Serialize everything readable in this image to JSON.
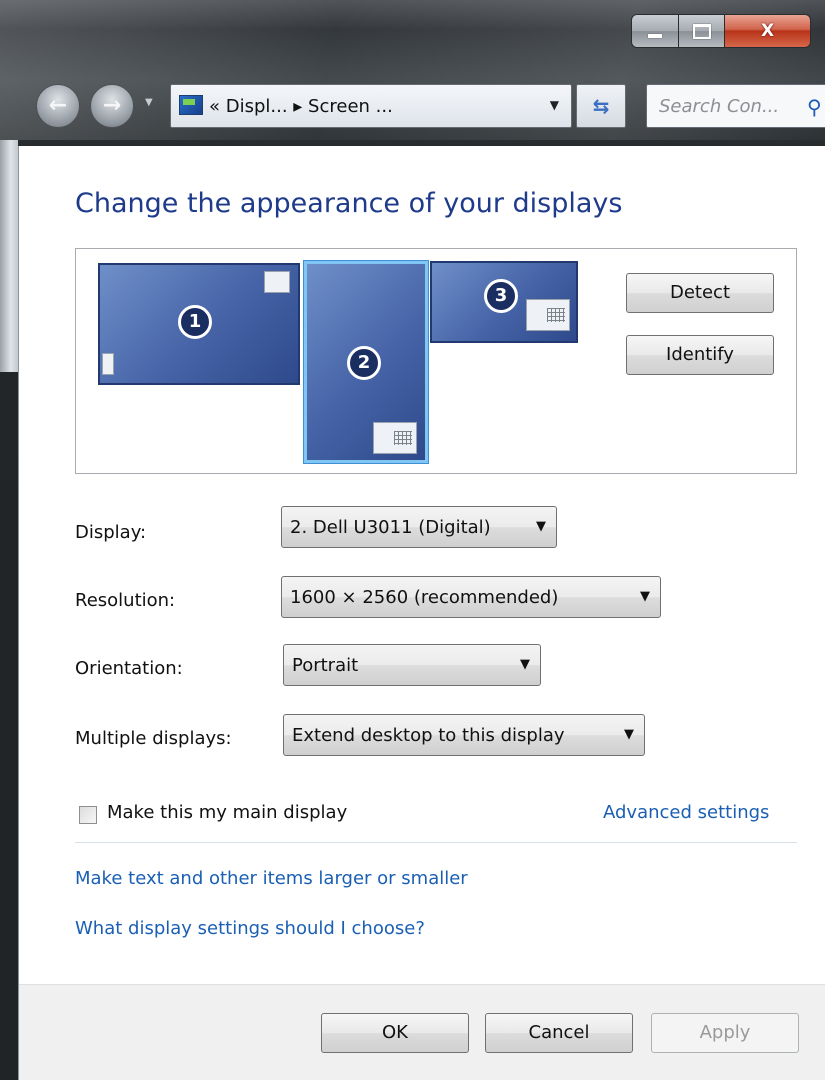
{
  "titlebar": {
    "controls": {
      "minimize": "minimize-icon",
      "maximize": "maximize-icon",
      "close_glyph": "X"
    }
  },
  "nav": {
    "back_icon": "back-arrow-icon",
    "forward_icon": "forward-arrow-icon",
    "address": "« Displ... ▸ Screen ...",
    "search_placeholder": "Search Con...",
    "search_icon": "search-icon"
  },
  "page": {
    "title": "Change the appearance of your displays",
    "monitors": [
      {
        "number": "1"
      },
      {
        "number": "2",
        "selected": true
      },
      {
        "number": "3"
      }
    ],
    "detect_label": "Detect",
    "identify_label": "Identify"
  },
  "settings": {
    "display_label": "Display:",
    "display_value": "2. Dell U3011 (Digital)",
    "resolution_label": "Resolution:",
    "resolution_value": "1600 × 2560 (recommended)",
    "orientation_label": "Orientation:",
    "orientation_value": "Portrait",
    "multiple_label": "Multiple displays:",
    "multiple_value": "Extend desktop to this display",
    "main_display_label": "Make this my main display",
    "main_display_checked": false,
    "advanced_link": "Advanced settings"
  },
  "links": {
    "text_size": "Make text and other items larger or smaller",
    "help": "What display settings should I choose?"
  },
  "footer": {
    "ok": "OK",
    "cancel": "Cancel",
    "apply": "Apply",
    "apply_enabled": false
  },
  "colors": {
    "title": "#1e3a8a",
    "link": "#1a5fb4",
    "monitor": "#4563a6",
    "selected_border": "#7fc6f5",
    "close": "#c8442a"
  }
}
